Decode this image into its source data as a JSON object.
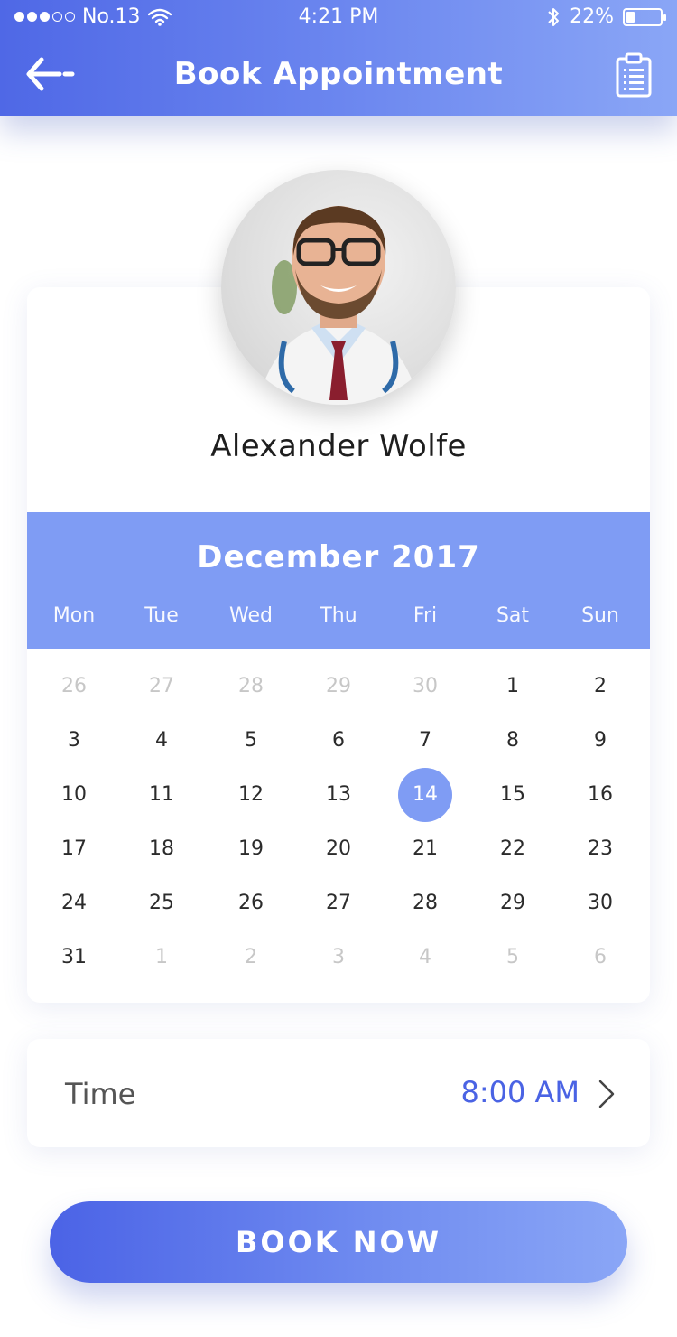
{
  "status_bar": {
    "carrier": "No.13",
    "time": "4:21 PM",
    "battery_percent": "22%"
  },
  "header": {
    "title": "Book Appointment",
    "back_icon": "back-arrow-icon",
    "action_icon": "clipboard-icon"
  },
  "doctor": {
    "name": "Alexander Wolfe"
  },
  "calendar": {
    "month": "December 2017",
    "weekdays": [
      "Mon",
      "Tue",
      "Wed",
      "Thu",
      "Fri",
      "Sat",
      "Sun"
    ],
    "selected_day": "14",
    "weeks": [
      [
        {
          "d": "26",
          "m": true
        },
        {
          "d": "27",
          "m": true
        },
        {
          "d": "28",
          "m": true
        },
        {
          "d": "29",
          "m": true
        },
        {
          "d": "30",
          "m": true
        },
        {
          "d": "1",
          "m": false
        },
        {
          "d": "2",
          "m": false
        }
      ],
      [
        {
          "d": "3",
          "m": false
        },
        {
          "d": "4",
          "m": false
        },
        {
          "d": "5",
          "m": false
        },
        {
          "d": "6",
          "m": false
        },
        {
          "d": "7",
          "m": false
        },
        {
          "d": "8",
          "m": false
        },
        {
          "d": "9",
          "m": false
        }
      ],
      [
        {
          "d": "10",
          "m": false
        },
        {
          "d": "11",
          "m": false
        },
        {
          "d": "12",
          "m": false
        },
        {
          "d": "13",
          "m": false
        },
        {
          "d": "14",
          "m": false
        },
        {
          "d": "15",
          "m": false
        },
        {
          "d": "16",
          "m": false
        }
      ],
      [
        {
          "d": "17",
          "m": false
        },
        {
          "d": "18",
          "m": false
        },
        {
          "d": "19",
          "m": false
        },
        {
          "d": "20",
          "m": false
        },
        {
          "d": "21",
          "m": false
        },
        {
          "d": "22",
          "m": false
        },
        {
          "d": "23",
          "m": false
        }
      ],
      [
        {
          "d": "24",
          "m": false
        },
        {
          "d": "25",
          "m": false
        },
        {
          "d": "26",
          "m": false
        },
        {
          "d": "27",
          "m": false
        },
        {
          "d": "28",
          "m": false
        },
        {
          "d": "29",
          "m": false
        },
        {
          "d": "30",
          "m": false
        }
      ],
      [
        {
          "d": "31",
          "m": false
        },
        {
          "d": "1",
          "m": true
        },
        {
          "d": "2",
          "m": true
        },
        {
          "d": "3",
          "m": true
        },
        {
          "d": "4",
          "m": true
        },
        {
          "d": "5",
          "m": true
        },
        {
          "d": "6",
          "m": true
        }
      ]
    ]
  },
  "time": {
    "label": "Time",
    "value": "8:00 AM"
  },
  "book_button": {
    "label": "BOOK NOW"
  },
  "colors": {
    "accent": "#7f9cf4",
    "primary": "#4a63e4"
  }
}
